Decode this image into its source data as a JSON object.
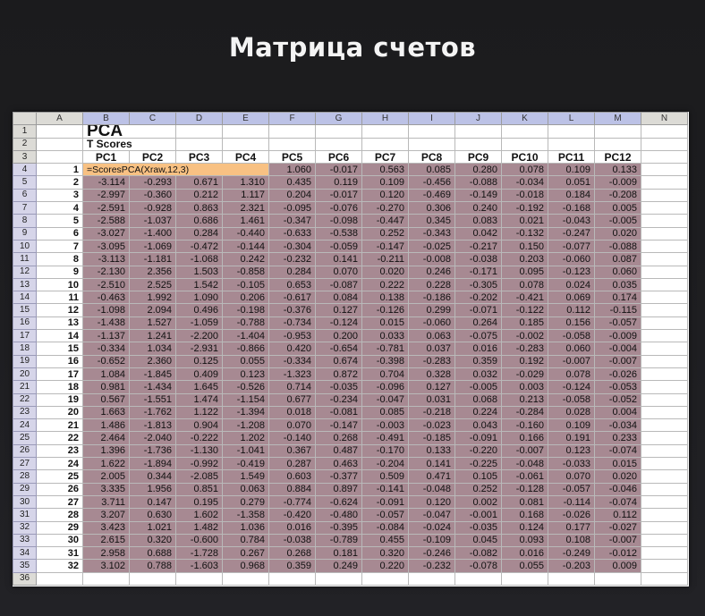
{
  "slide": {
    "title": "Матрица счетов"
  },
  "sheet": {
    "columns": [
      "A",
      "B",
      "C",
      "D",
      "E",
      "F",
      "G",
      "H",
      "I",
      "J",
      "K",
      "L",
      "M",
      "N"
    ],
    "title": "PCA",
    "subtitle": "T Scores",
    "pc_headers": [
      "PC1",
      "PC2",
      "PC3",
      "PC4",
      "PC5",
      "PC6",
      "PC7",
      "PC8",
      "PC9",
      "PC10",
      "PC11",
      "PC12"
    ],
    "formula": "=ScoresPCA(Xraw,12,3)",
    "first_row_rest": [
      "1.060",
      "-0.017",
      "0.563",
      "0.085",
      "0.280",
      "0.078",
      "0.109",
      "0.133"
    ],
    "rows": [
      [
        "2",
        "-3.114",
        "-0.293",
        "0.671",
        "1.310",
        "0.435",
        "0.119",
        "0.109",
        "-0.456",
        "-0.088",
        "-0.034",
        "0.051",
        "-0.009"
      ],
      [
        "3",
        "-2.997",
        "-0.360",
        "0.212",
        "1.117",
        "0.204",
        "-0.017",
        "0.120",
        "-0.469",
        "-0.149",
        "-0.018",
        "0.184",
        "-0.208"
      ],
      [
        "4",
        "-2.591",
        "-0.928",
        "0.863",
        "2.321",
        "-0.095",
        "-0.076",
        "-0.270",
        "0.306",
        "0.240",
        "-0.192",
        "-0.168",
        "0.005"
      ],
      [
        "5",
        "-2.588",
        "-1.037",
        "0.686",
        "1.461",
        "-0.347",
        "-0.098",
        "-0.447",
        "0.345",
        "0.083",
        "0.021",
        "-0.043",
        "-0.005"
      ],
      [
        "6",
        "-3.027",
        "-1.400",
        "0.284",
        "-0.440",
        "-0.633",
        "-0.538",
        "0.252",
        "-0.343",
        "0.042",
        "-0.132",
        "-0.247",
        "0.020"
      ],
      [
        "7",
        "-3.095",
        "-1.069",
        "-0.472",
        "-0.144",
        "-0.304",
        "-0.059",
        "-0.147",
        "-0.025",
        "-0.217",
        "0.150",
        "-0.077",
        "-0.088"
      ],
      [
        "8",
        "-3.113",
        "-1.181",
        "-1.068",
        "0.242",
        "-0.232",
        "0.141",
        "-0.211",
        "-0.008",
        "-0.038",
        "0.203",
        "-0.060",
        "0.087"
      ],
      [
        "9",
        "-2.130",
        "2.356",
        "1.503",
        "-0.858",
        "0.284",
        "0.070",
        "0.020",
        "0.246",
        "-0.171",
        "0.095",
        "-0.123",
        "0.060"
      ],
      [
        "10",
        "-2.510",
        "2.525",
        "1.542",
        "-0.105",
        "0.653",
        "-0.087",
        "0.222",
        "0.228",
        "-0.305",
        "0.078",
        "0.024",
        "0.035"
      ],
      [
        "11",
        "-0.463",
        "1.992",
        "1.090",
        "0.206",
        "-0.617",
        "0.084",
        "0.138",
        "-0.186",
        "-0.202",
        "-0.421",
        "0.069",
        "0.174"
      ],
      [
        "12",
        "-1.098",
        "2.094",
        "0.496",
        "-0.198",
        "-0.376",
        "0.127",
        "-0.126",
        "0.299",
        "-0.071",
        "-0.122",
        "0.112",
        "-0.115"
      ],
      [
        "13",
        "-1.438",
        "1.527",
        "-1.059",
        "-0.788",
        "-0.734",
        "-0.124",
        "0.015",
        "-0.060",
        "0.264",
        "0.185",
        "0.156",
        "-0.057"
      ],
      [
        "14",
        "-1.137",
        "1.241",
        "-2.200",
        "-1.404",
        "-0.953",
        "0.200",
        "0.033",
        "0.063",
        "-0.075",
        "-0.002",
        "-0.058",
        "-0.009"
      ],
      [
        "15",
        "-0.334",
        "1.034",
        "-2.931",
        "-0.866",
        "0.420",
        "-0.654",
        "-0.781",
        "0.037",
        "0.016",
        "-0.283",
        "0.060",
        "-0.004"
      ],
      [
        "16",
        "-0.652",
        "2.360",
        "0.125",
        "0.055",
        "-0.334",
        "0.674",
        "-0.398",
        "-0.283",
        "0.359",
        "0.192",
        "-0.007",
        "-0.007"
      ],
      [
        "17",
        "1.084",
        "-1.845",
        "0.409",
        "0.123",
        "-1.323",
        "0.872",
        "0.704",
        "0.328",
        "0.032",
        "-0.029",
        "0.078",
        "-0.026"
      ],
      [
        "18",
        "0.981",
        "-1.434",
        "1.645",
        "-0.526",
        "0.714",
        "-0.035",
        "-0.096",
        "0.127",
        "-0.005",
        "0.003",
        "-0.124",
        "-0.053"
      ],
      [
        "19",
        "0.567",
        "-1.551",
        "1.474",
        "-1.154",
        "0.677",
        "-0.234",
        "-0.047",
        "0.031",
        "0.068",
        "0.213",
        "-0.058",
        "-0.052"
      ],
      [
        "20",
        "1.663",
        "-1.762",
        "1.122",
        "-1.394",
        "0.018",
        "-0.081",
        "0.085",
        "-0.218",
        "0.224",
        "-0.284",
        "0.028",
        "0.004"
      ],
      [
        "21",
        "1.486",
        "-1.813",
        "0.904",
        "-1.208",
        "0.070",
        "-0.147",
        "-0.003",
        "-0.023",
        "0.043",
        "-0.160",
        "0.109",
        "-0.034"
      ],
      [
        "22",
        "2.464",
        "-2.040",
        "-0.222",
        "1.202",
        "-0.140",
        "0.268",
        "-0.491",
        "-0.185",
        "-0.091",
        "0.166",
        "0.191",
        "0.233"
      ],
      [
        "23",
        "1.396",
        "-1.736",
        "-1.130",
        "-1.041",
        "0.367",
        "0.487",
        "-0.170",
        "0.133",
        "-0.220",
        "-0.007",
        "0.123",
        "-0.074"
      ],
      [
        "24",
        "1.622",
        "-1.894",
        "-0.992",
        "-0.419",
        "0.287",
        "0.463",
        "-0.204",
        "0.141",
        "-0.225",
        "-0.048",
        "-0.033",
        "0.015"
      ],
      [
        "25",
        "2.005",
        "0.344",
        "-2.085",
        "1.549",
        "0.603",
        "-0.377",
        "0.509",
        "0.471",
        "0.105",
        "-0.061",
        "0.070",
        "0.020"
      ],
      [
        "26",
        "3.335",
        "1.956",
        "0.851",
        "0.063",
        "0.884",
        "0.897",
        "-0.141",
        "-0.048",
        "0.252",
        "-0.128",
        "-0.057",
        "-0.046"
      ],
      [
        "27",
        "3.711",
        "0.147",
        "0.195",
        "0.279",
        "-0.774",
        "-0.624",
        "-0.091",
        "0.120",
        "0.002",
        "0.081",
        "-0.114",
        "-0.074"
      ],
      [
        "28",
        "3.207",
        "0.630",
        "1.602",
        "-1.358",
        "-0.420",
        "-0.480",
        "-0.057",
        "-0.047",
        "-0.001",
        "0.168",
        "-0.026",
        "0.112"
      ],
      [
        "29",
        "3.423",
        "1.021",
        "1.482",
        "1.036",
        "0.016",
        "-0.395",
        "-0.084",
        "-0.024",
        "-0.035",
        "0.124",
        "0.177",
        "-0.027"
      ],
      [
        "30",
        "2.615",
        "0.320",
        "-0.600",
        "0.784",
        "-0.038",
        "-0.789",
        "0.455",
        "-0.109",
        "0.045",
        "0.093",
        "0.108",
        "-0.007"
      ],
      [
        "31",
        "2.958",
        "0.688",
        "-1.728",
        "0.267",
        "0.268",
        "0.181",
        "0.320",
        "-0.246",
        "-0.082",
        "0.016",
        "-0.249",
        "-0.012"
      ],
      [
        "32",
        "3.102",
        "0.788",
        "-1.603",
        "0.968",
        "0.359",
        "0.249",
        "0.220",
        "-0.232",
        "-0.078",
        "0.055",
        "-0.203",
        "0.009"
      ]
    ],
    "colors": {
      "selection": "#a78992",
      "formula_cell": "#f8c183",
      "row_header_selected": "#d6d5e9"
    }
  }
}
